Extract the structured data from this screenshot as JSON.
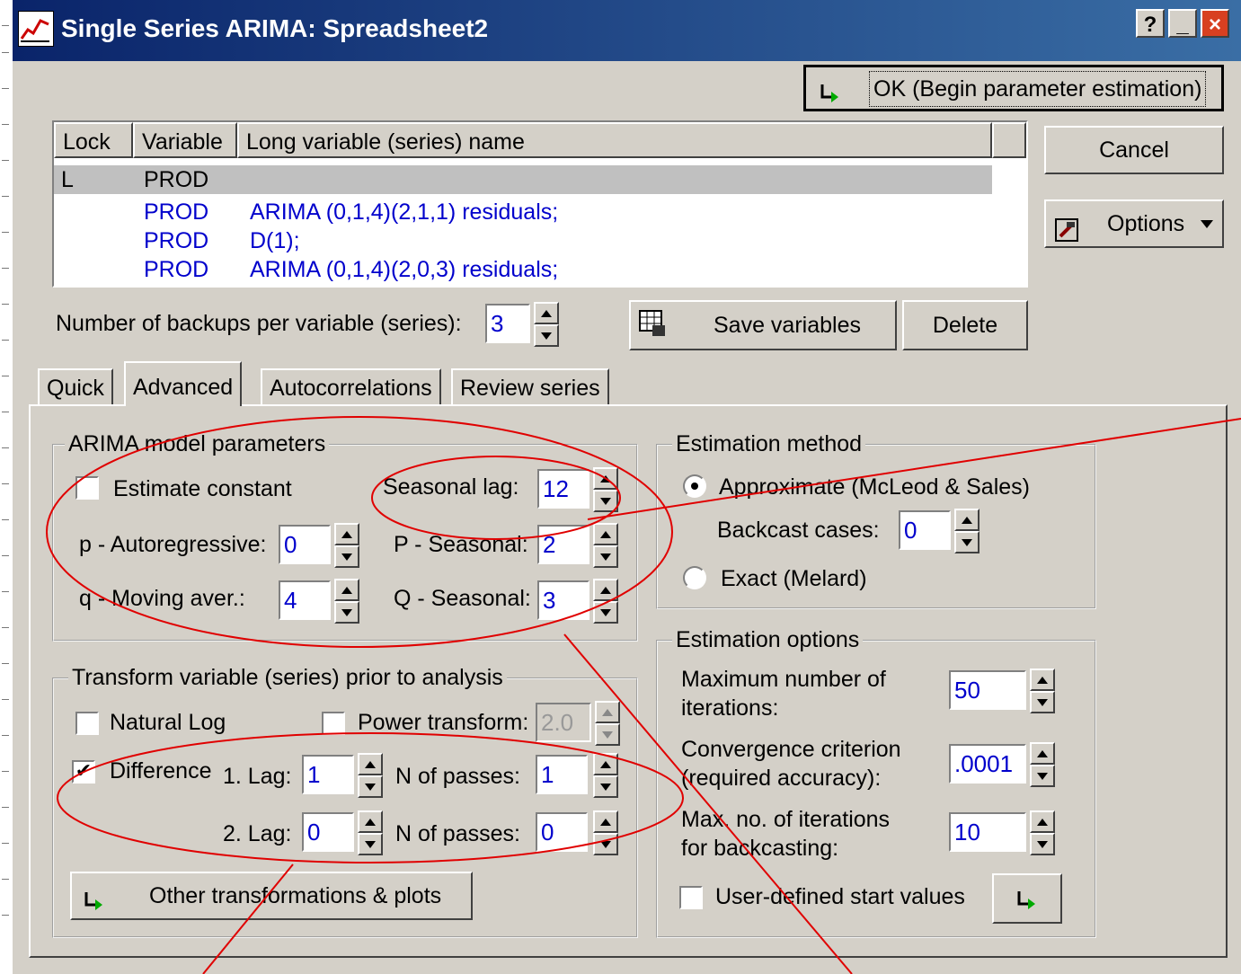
{
  "window": {
    "title": "Single Series ARIMA: Spreadsheet2",
    "help_btn": "?",
    "min_btn": "_",
    "close_btn": "×"
  },
  "buttons": {
    "ok": "OK (Begin parameter estimation)",
    "cancel": "Cancel",
    "options": "Options",
    "save_vars": "Save variables",
    "delete": "Delete",
    "other_transforms": "Other transformations & plots"
  },
  "list": {
    "headers": [
      "Lock",
      "Variable",
      "Long variable (series) name"
    ],
    "rows": [
      {
        "lock": "L",
        "variable": "PROD",
        "name": ""
      },
      {
        "lock": "",
        "variable": "PROD",
        "name": "ARIMA (0,1,4)(2,1,1) residuals;"
      },
      {
        "lock": "",
        "variable": "PROD",
        "name": "D(1);"
      },
      {
        "lock": "",
        "variable": "PROD",
        "name": "ARIMA (0,1,4)(2,0,3) residuals;"
      }
    ]
  },
  "backups": {
    "label": "Number of backups per variable (series):",
    "value": "3"
  },
  "tabs": [
    "Quick",
    "Advanced",
    "Autocorrelations",
    "Review series"
  ],
  "arima": {
    "title": "ARIMA model parameters",
    "estimate_constant": "Estimate constant",
    "seasonal_lag_label": "Seasonal lag:",
    "seasonal_lag": "12",
    "p_label": "p - Autoregressive:",
    "p": "0",
    "P_label": "P - Seasonal:",
    "P": "2",
    "q_label": "q - Moving aver.:",
    "q": "4",
    "Q_label": "Q - Seasonal:",
    "Q": "3"
  },
  "transform": {
    "title": "Transform variable (series) prior to analysis",
    "natural_log": "Natural Log",
    "power": "Power transform:",
    "power_value": "2.0",
    "difference": "Difference",
    "lag1_label": "1. Lag:",
    "lag1": "1",
    "passes1_label": "N of passes:",
    "passes1": "1",
    "lag2_label": "2. Lag:",
    "lag2": "0",
    "passes2_label": "N of passes:",
    "passes2": "0"
  },
  "estimation_method": {
    "title": "Estimation method",
    "approximate": "Approximate (McLeod & Sales)",
    "backcast_label": "Backcast cases:",
    "backcast": "0",
    "exact": "Exact (Melard)"
  },
  "estimation_options": {
    "title": "Estimation options",
    "max_iter_label": "Maximum number of\niterations:",
    "max_iter": "50",
    "conv_label": "Convergence criterion\n(required accuracy):",
    "conv": ".0001",
    "backcast_iter_label": "Max. no. of iterations\nfor backcasting:",
    "backcast_iter": "10",
    "user_start": "User-defined start values"
  },
  "colors": {
    "annotation": "#e00000",
    "title_bar": "#0a246a",
    "value_text": "#0000cc"
  }
}
